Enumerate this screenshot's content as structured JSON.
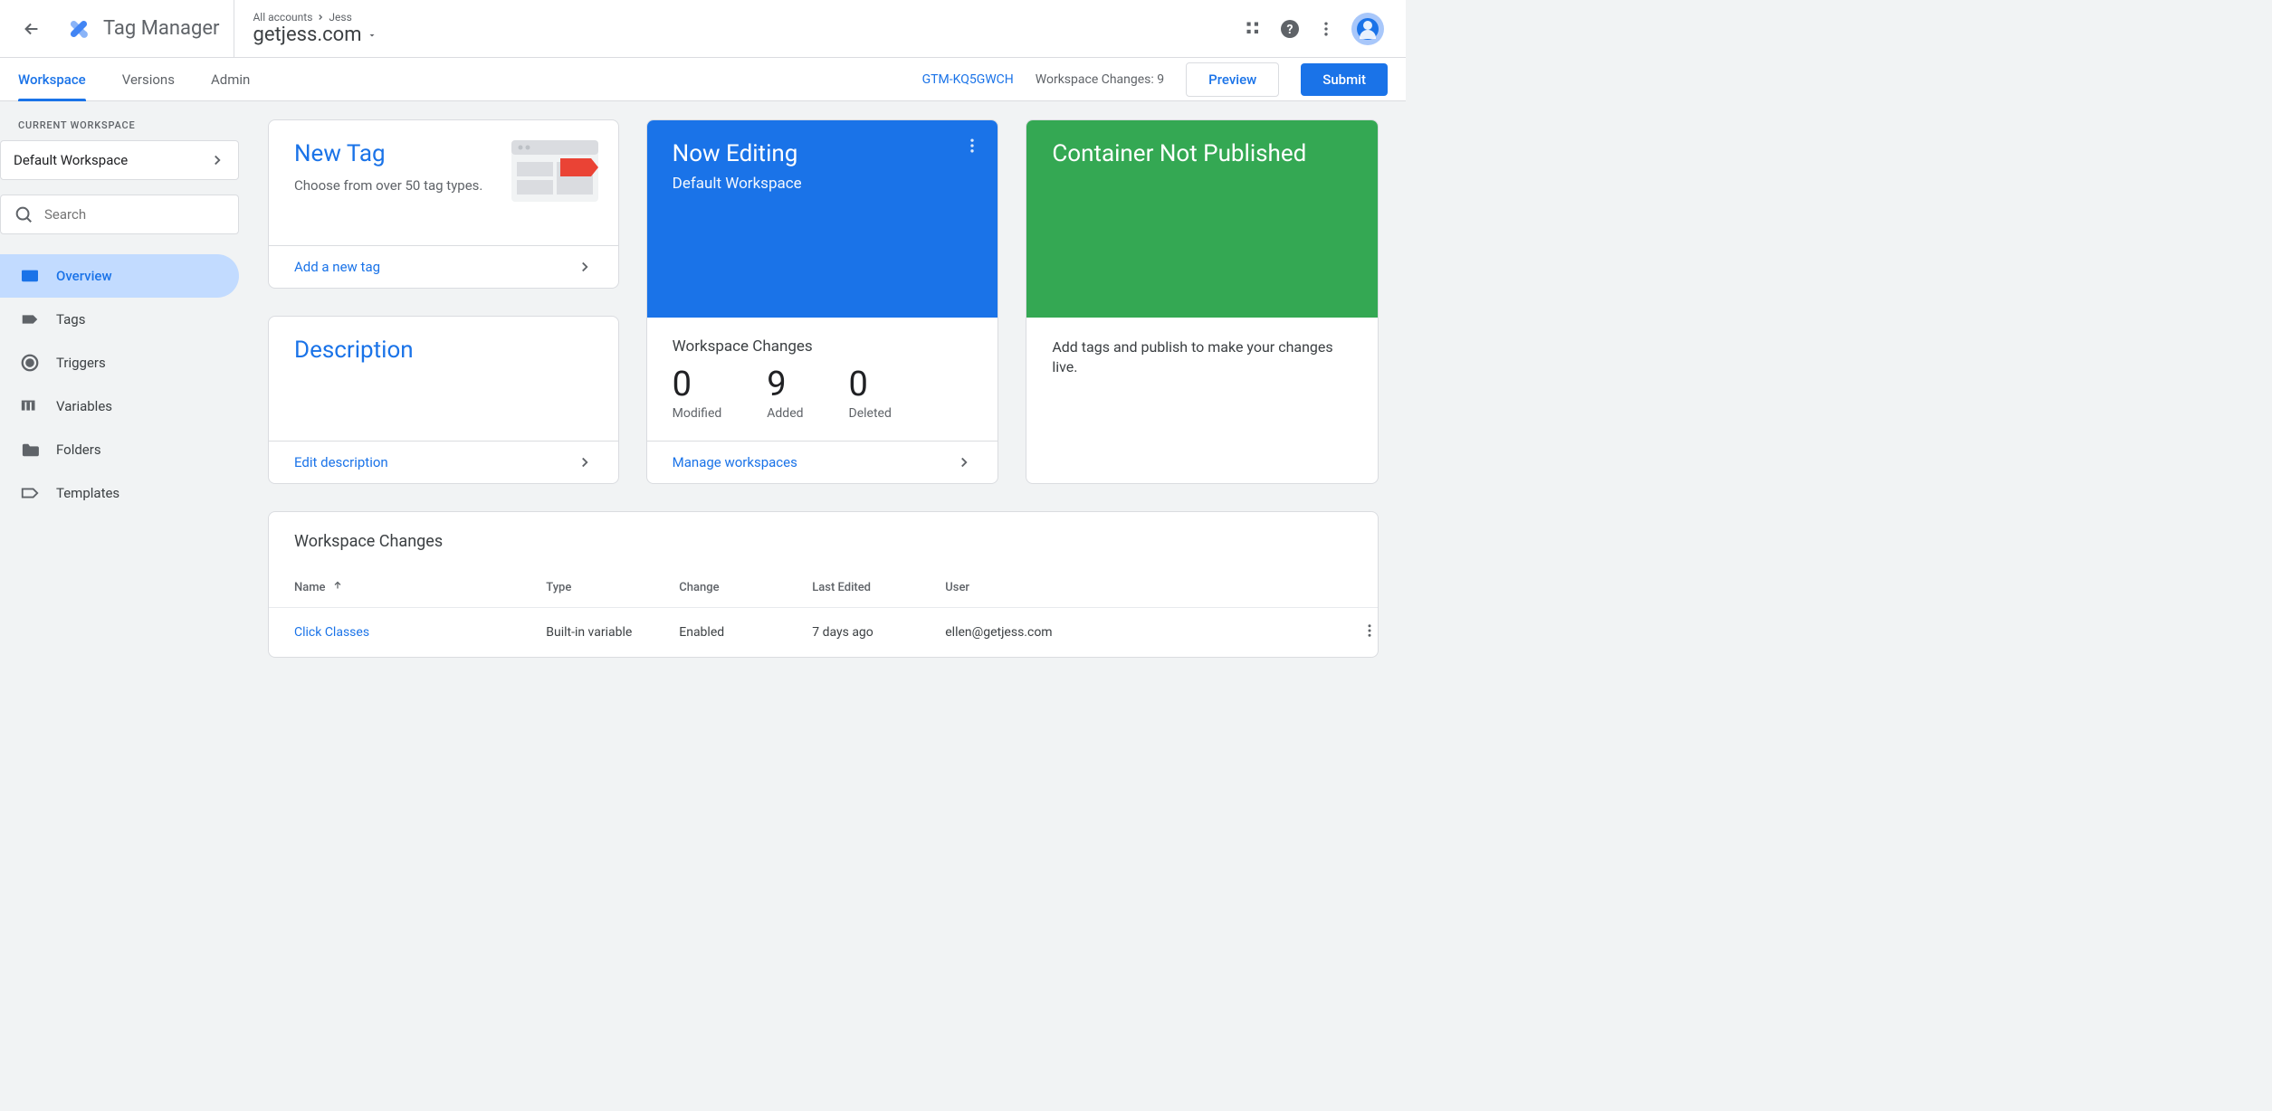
{
  "app": {
    "title": "Tag Manager"
  },
  "breadcrumbs": {
    "root": "All accounts",
    "account": "Jess"
  },
  "container": {
    "name": "getjess.com",
    "id": "GTM-KQ5GWCH"
  },
  "tabs": {
    "workspace": "Workspace",
    "versions": "Versions",
    "admin": "Admin"
  },
  "tabbar": {
    "changes_label": "Workspace Changes: 9",
    "preview": "Preview",
    "submit": "Submit"
  },
  "sidebar": {
    "current_label": "CURRENT WORKSPACE",
    "workspace_name": "Default Workspace",
    "search_placeholder": "Search",
    "nav": {
      "overview": "Overview",
      "tags": "Tags",
      "triggers": "Triggers",
      "variables": "Variables",
      "folders": "Folders",
      "templates": "Templates"
    }
  },
  "cards": {
    "newtag": {
      "title": "New Tag",
      "sub": "Choose from over 50 tag types.",
      "action": "Add a new tag"
    },
    "description": {
      "title": "Description",
      "action": "Edit description"
    },
    "editing": {
      "title": "Now Editing",
      "sub": "Default Workspace",
      "changes_title": "Workspace Changes",
      "stats": {
        "modified_n": "0",
        "modified_l": "Modified",
        "added_n": "9",
        "added_l": "Added",
        "deleted_n": "0",
        "deleted_l": "Deleted"
      },
      "action": "Manage workspaces"
    },
    "publish": {
      "title": "Container Not Published",
      "body": "Add tags and publish to make your changes live."
    }
  },
  "table": {
    "title": "Workspace Changes",
    "headers": {
      "name": "Name",
      "type": "Type",
      "change": "Change",
      "last_edited": "Last Edited",
      "user": "User"
    },
    "rows": [
      {
        "name": "Click Classes",
        "type": "Built-in variable",
        "change": "Enabled",
        "last_edited": "7 days ago",
        "user": "ellen@getjess.com"
      }
    ]
  }
}
